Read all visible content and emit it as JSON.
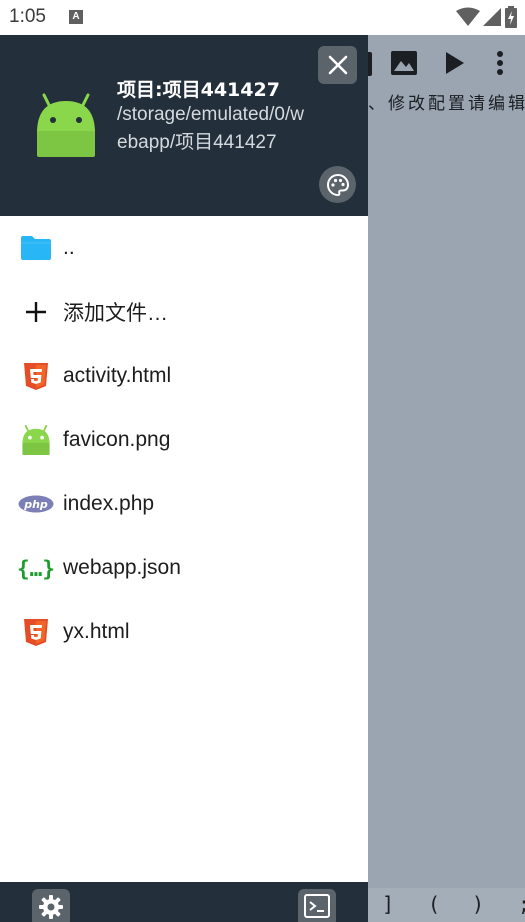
{
  "status_bar": {
    "time": "1:05",
    "notification_letter": "A",
    "icons": [
      "wifi-icon",
      "signal-icon",
      "battery-icon"
    ]
  },
  "drawer": {
    "header": {
      "title": "项目:项目441427",
      "path": "/storage/emulated/0/webapp/项目441427",
      "logo": "android-robot-icon",
      "close_icon": "close-icon",
      "palette_icon": "palette-icon",
      "background_color": "#232f3a"
    },
    "files": [
      {
        "name": "..",
        "icon": "folder-icon"
      },
      {
        "name": "添加文件…",
        "icon": "plus-icon"
      },
      {
        "name": "activity.html",
        "icon": "html5-icon"
      },
      {
        "name": "favicon.png",
        "icon": "android-robot-icon"
      },
      {
        "name": "index.php",
        "icon": "php-icon"
      },
      {
        "name": "webapp.json",
        "icon": "json-braces-icon"
      },
      {
        "name": "yx.html",
        "icon": "html5-icon"
      }
    ],
    "footer": {
      "settings_icon": "gear-icon",
      "terminal_icon": "terminal-icon"
    }
  },
  "background_app": {
    "menu_text": "、修改配置请编辑",
    "toolbar_icons": [
      "image-icon",
      "play-icon",
      "more-vertical-icon"
    ],
    "bottom_symbols": [
      "]",
      "(",
      ")",
      ";"
    ]
  }
}
